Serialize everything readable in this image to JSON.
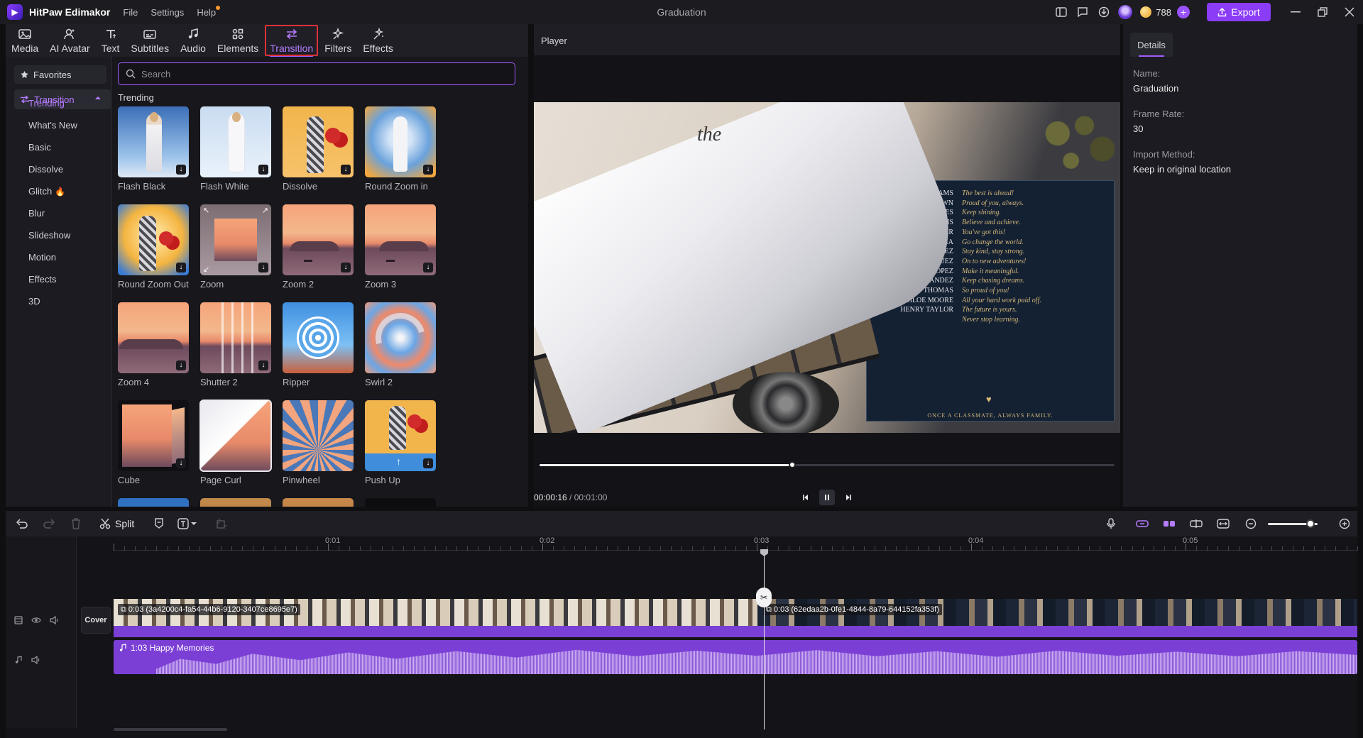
{
  "app": {
    "name": "HitPaw Edimakor",
    "menus": [
      "File",
      "Settings",
      "Help"
    ],
    "window_title": "Graduation",
    "coins": "788",
    "export_label": "Export"
  },
  "tools": [
    {
      "label": "Media",
      "icon": "media-icon"
    },
    {
      "label": "AI Avatar",
      "icon": "ai-avatar-icon"
    },
    {
      "label": "Text",
      "icon": "text-icon"
    },
    {
      "label": "Subtitles",
      "icon": "subtitles-icon"
    },
    {
      "label": "Audio",
      "icon": "audio-icon"
    },
    {
      "label": "Elements",
      "icon": "elements-icon"
    },
    {
      "label": "Transition",
      "icon": "transition-icon",
      "active": true
    },
    {
      "label": "Filters",
      "icon": "filters-icon"
    },
    {
      "label": "Effects",
      "icon": "effects-icon"
    }
  ],
  "categories": {
    "favorites": "Favorites",
    "transition": "Transition",
    "sub": [
      "Trending",
      "What's New",
      "Basic",
      "Dissolve",
      "Glitch",
      "Blur",
      "Slideshow",
      "Motion",
      "Effects",
      "3D"
    ],
    "active_sub": "Trending"
  },
  "library": {
    "search_placeholder": "Search",
    "section_title": "Trending",
    "items": [
      {
        "label": "Flash Black"
      },
      {
        "label": "Flash White"
      },
      {
        "label": "Dissolve"
      },
      {
        "label": "Round Zoom in"
      },
      {
        "label": "Round Zoom Out"
      },
      {
        "label": "Zoom"
      },
      {
        "label": "Zoom 2"
      },
      {
        "label": "Zoom 3"
      },
      {
        "label": "Zoom 4"
      },
      {
        "label": "Shutter 2"
      },
      {
        "label": "Ripper"
      },
      {
        "label": "Swirl 2"
      },
      {
        "label": "Cube"
      },
      {
        "label": "Page Curl"
      },
      {
        "label": "Pinwheel"
      },
      {
        "label": "Push Up"
      }
    ]
  },
  "player": {
    "title": "Player",
    "current_time": "00:00:16",
    "total_time": "00:01:00",
    "progress": 0.44,
    "video": {
      "title_script": "the",
      "names": [
        [
          "WILLIAMS",
          "The best is ahead!"
        ],
        [
          "OLIVIA BROWN",
          "Proud of you, always."
        ],
        [
          "MICHAEL JONES",
          "Keep shining."
        ],
        [
          "SOPHIA DAVIS",
          "Believe and achieve."
        ],
        [
          "WILLIAM MILLER",
          "You've got this!"
        ],
        [
          "ISABELLA GARCIA",
          "Go change the world."
        ],
        [
          "ETHAN MARTINEZ",
          "Stay kind, stay strong."
        ],
        [
          "AVA RODRIGUEZ",
          "On to new adventures!"
        ],
        [
          "BENJAMIN LOPEZ",
          "Make it meaningful."
        ],
        [
          "MIA HERNANDEZ",
          "Keep chasing dreams."
        ],
        [
          "LUCAS THOMAS",
          "So proud of you!"
        ],
        [
          "CHLOE MOORE",
          "All your hard work paid off."
        ],
        [
          "HENRY TAYLOR",
          "The future is yours."
        ],
        [
          "",
          "Never stop learning."
        ]
      ],
      "footer": "ONCE A CLASSMATE, ALWAYS FAMILY."
    }
  },
  "details": {
    "tab": "Details",
    "name_label": "Name:",
    "name_value": "Graduation",
    "frame_rate_label": "Frame Rate:",
    "frame_rate_value": "30",
    "import_label": "Import Method:",
    "import_value": "Keep in original location"
  },
  "timeline": {
    "split_label": "Split",
    "ruler": [
      "0:01",
      "0:02",
      "0:03",
      "0:04",
      "0:05"
    ],
    "cover_label": "Cover",
    "clips": [
      {
        "label": "0:03 (3a4200c4-fa54-44b6-9120-3407ce8695e7)"
      },
      {
        "label": "0:03 (62edaa2b-0fe1-4844-8a79-644152fa353f)"
      }
    ],
    "audio_label": "1:03 Happy Memories",
    "zoom_level": 0.85
  },
  "colors": {
    "accent": "#8b3cf7",
    "active_text": "#b57cff",
    "highlight_border": "#e0303a"
  }
}
